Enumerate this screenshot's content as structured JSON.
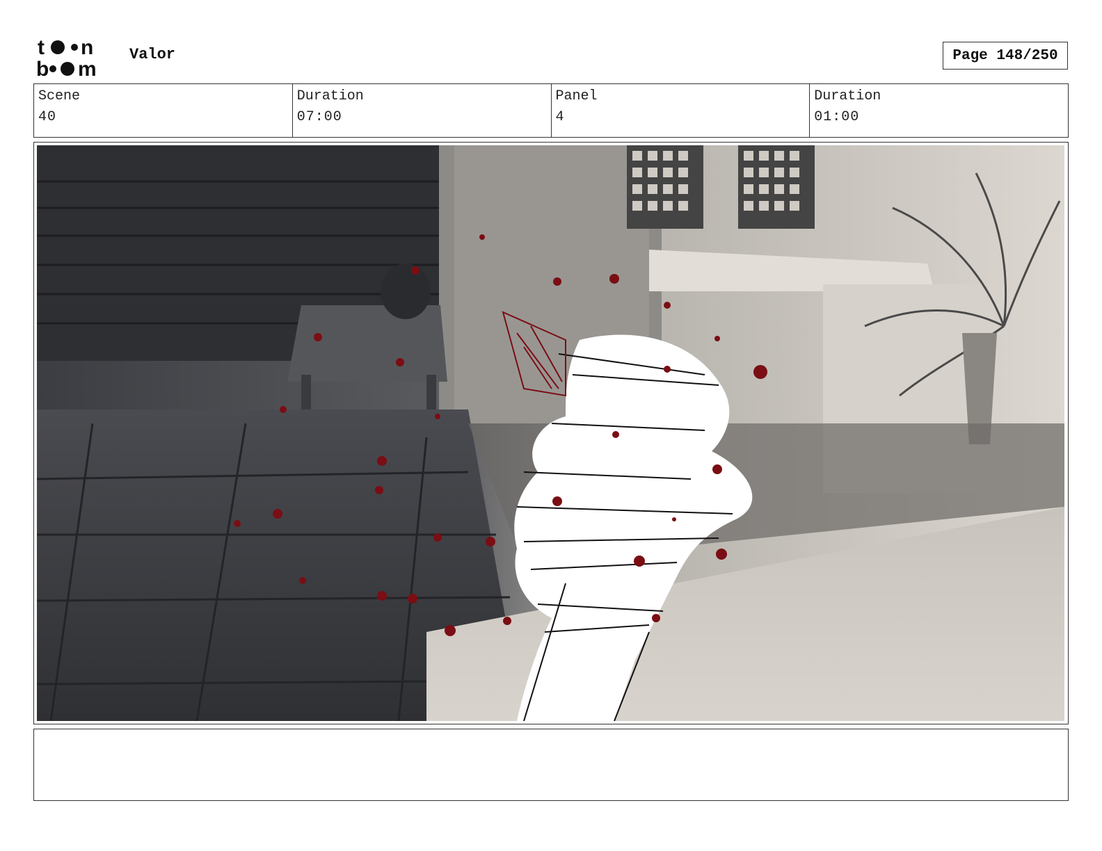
{
  "header": {
    "logo_alt": "toon boom",
    "project_title": "Valor",
    "page_label": "Page 148/250"
  },
  "info": {
    "scene_label": "Scene",
    "scene_value": "40",
    "scene_duration_label": "Duration",
    "scene_duration_value": "07:00",
    "panel_label": "Panel",
    "panel_value": "4",
    "panel_duration_label": "Duration",
    "panel_duration_value": "01:00"
  },
  "panel": {
    "image_description_icon": "storyboard-sketch",
    "blood_color": "#7a0e14",
    "sketch_color": "#ffffff"
  },
  "notes": {
    "text": ""
  }
}
